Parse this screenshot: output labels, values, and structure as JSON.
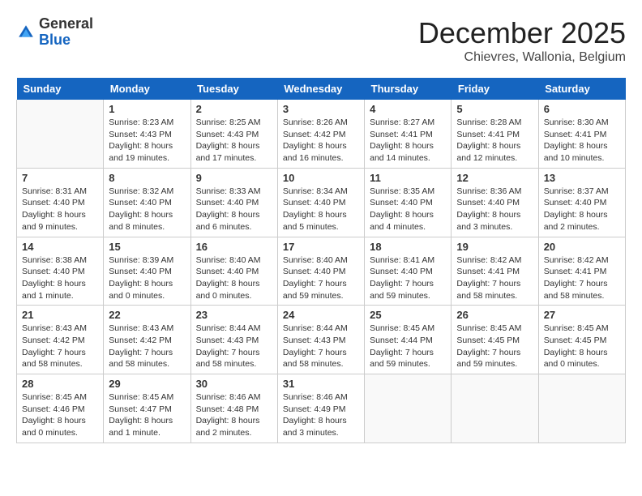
{
  "header": {
    "logo_general": "General",
    "logo_blue": "Blue",
    "month_title": "December 2025",
    "location": "Chievres, Wallonia, Belgium"
  },
  "days_of_week": [
    "Sunday",
    "Monday",
    "Tuesday",
    "Wednesday",
    "Thursday",
    "Friday",
    "Saturday"
  ],
  "weeks": [
    [
      {
        "day": "",
        "info": ""
      },
      {
        "day": "1",
        "info": "Sunrise: 8:23 AM\nSunset: 4:43 PM\nDaylight: 8 hours\nand 19 minutes."
      },
      {
        "day": "2",
        "info": "Sunrise: 8:25 AM\nSunset: 4:43 PM\nDaylight: 8 hours\nand 17 minutes."
      },
      {
        "day": "3",
        "info": "Sunrise: 8:26 AM\nSunset: 4:42 PM\nDaylight: 8 hours\nand 16 minutes."
      },
      {
        "day": "4",
        "info": "Sunrise: 8:27 AM\nSunset: 4:41 PM\nDaylight: 8 hours\nand 14 minutes."
      },
      {
        "day": "5",
        "info": "Sunrise: 8:28 AM\nSunset: 4:41 PM\nDaylight: 8 hours\nand 12 minutes."
      },
      {
        "day": "6",
        "info": "Sunrise: 8:30 AM\nSunset: 4:41 PM\nDaylight: 8 hours\nand 10 minutes."
      }
    ],
    [
      {
        "day": "7",
        "info": "Sunrise: 8:31 AM\nSunset: 4:40 PM\nDaylight: 8 hours\nand 9 minutes."
      },
      {
        "day": "8",
        "info": "Sunrise: 8:32 AM\nSunset: 4:40 PM\nDaylight: 8 hours\nand 8 minutes."
      },
      {
        "day": "9",
        "info": "Sunrise: 8:33 AM\nSunset: 4:40 PM\nDaylight: 8 hours\nand 6 minutes."
      },
      {
        "day": "10",
        "info": "Sunrise: 8:34 AM\nSunset: 4:40 PM\nDaylight: 8 hours\nand 5 minutes."
      },
      {
        "day": "11",
        "info": "Sunrise: 8:35 AM\nSunset: 4:40 PM\nDaylight: 8 hours\nand 4 minutes."
      },
      {
        "day": "12",
        "info": "Sunrise: 8:36 AM\nSunset: 4:40 PM\nDaylight: 8 hours\nand 3 minutes."
      },
      {
        "day": "13",
        "info": "Sunrise: 8:37 AM\nSunset: 4:40 PM\nDaylight: 8 hours\nand 2 minutes."
      }
    ],
    [
      {
        "day": "14",
        "info": "Sunrise: 8:38 AM\nSunset: 4:40 PM\nDaylight: 8 hours\nand 1 minute."
      },
      {
        "day": "15",
        "info": "Sunrise: 8:39 AM\nSunset: 4:40 PM\nDaylight: 8 hours\nand 0 minutes."
      },
      {
        "day": "16",
        "info": "Sunrise: 8:40 AM\nSunset: 4:40 PM\nDaylight: 8 hours\nand 0 minutes."
      },
      {
        "day": "17",
        "info": "Sunrise: 8:40 AM\nSunset: 4:40 PM\nDaylight: 7 hours\nand 59 minutes."
      },
      {
        "day": "18",
        "info": "Sunrise: 8:41 AM\nSunset: 4:40 PM\nDaylight: 7 hours\nand 59 minutes."
      },
      {
        "day": "19",
        "info": "Sunrise: 8:42 AM\nSunset: 4:41 PM\nDaylight: 7 hours\nand 58 minutes."
      },
      {
        "day": "20",
        "info": "Sunrise: 8:42 AM\nSunset: 4:41 PM\nDaylight: 7 hours\nand 58 minutes."
      }
    ],
    [
      {
        "day": "21",
        "info": "Sunrise: 8:43 AM\nSunset: 4:42 PM\nDaylight: 7 hours\nand 58 minutes."
      },
      {
        "day": "22",
        "info": "Sunrise: 8:43 AM\nSunset: 4:42 PM\nDaylight: 7 hours\nand 58 minutes."
      },
      {
        "day": "23",
        "info": "Sunrise: 8:44 AM\nSunset: 4:43 PM\nDaylight: 7 hours\nand 58 minutes."
      },
      {
        "day": "24",
        "info": "Sunrise: 8:44 AM\nSunset: 4:43 PM\nDaylight: 7 hours\nand 58 minutes."
      },
      {
        "day": "25",
        "info": "Sunrise: 8:45 AM\nSunset: 4:44 PM\nDaylight: 7 hours\nand 59 minutes."
      },
      {
        "day": "26",
        "info": "Sunrise: 8:45 AM\nSunset: 4:45 PM\nDaylight: 7 hours\nand 59 minutes."
      },
      {
        "day": "27",
        "info": "Sunrise: 8:45 AM\nSunset: 4:45 PM\nDaylight: 8 hours\nand 0 minutes."
      }
    ],
    [
      {
        "day": "28",
        "info": "Sunrise: 8:45 AM\nSunset: 4:46 PM\nDaylight: 8 hours\nand 0 minutes."
      },
      {
        "day": "29",
        "info": "Sunrise: 8:45 AM\nSunset: 4:47 PM\nDaylight: 8 hours\nand 1 minute."
      },
      {
        "day": "30",
        "info": "Sunrise: 8:46 AM\nSunset: 4:48 PM\nDaylight: 8 hours\nand 2 minutes."
      },
      {
        "day": "31",
        "info": "Sunrise: 8:46 AM\nSunset: 4:49 PM\nDaylight: 8 hours\nand 3 minutes."
      },
      {
        "day": "",
        "info": ""
      },
      {
        "day": "",
        "info": ""
      },
      {
        "day": "",
        "info": ""
      }
    ]
  ]
}
